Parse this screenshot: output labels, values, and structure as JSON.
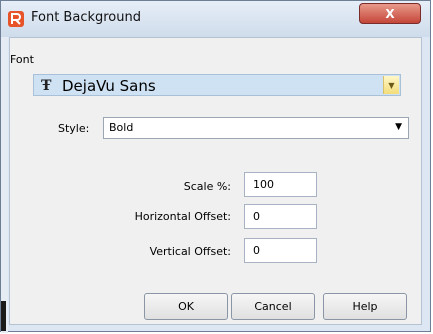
{
  "window": {
    "title": "Font Background",
    "close_glyph": "X"
  },
  "font_group": {
    "label": "Font",
    "font_icon_glyph": "Ŧ",
    "font_name": "DejaVu Sans"
  },
  "style": {
    "label": "Style:",
    "value": "Bold"
  },
  "scale": {
    "label": "Scale %:",
    "value": "100"
  },
  "horizontal_offset": {
    "label": "Horizontal Offset:",
    "value": "0"
  },
  "vertical_offset": {
    "label": "Vertical Offset:",
    "value": "0"
  },
  "buttons": {
    "ok": "OK",
    "cancel": "Cancel",
    "help": "Help"
  },
  "icons": {
    "app": "app-logo-icon",
    "font": "font-type-icon",
    "dropdown": "chevron-down-icon",
    "close": "close-icon"
  },
  "colors": {
    "title_gradient_top": "#e6eef8",
    "close_red": "#c4463a",
    "selection_blue": "#cfe2f4",
    "dropdown_yellow": "#f3dc7a",
    "app_icon_orange": "#e8542a"
  }
}
